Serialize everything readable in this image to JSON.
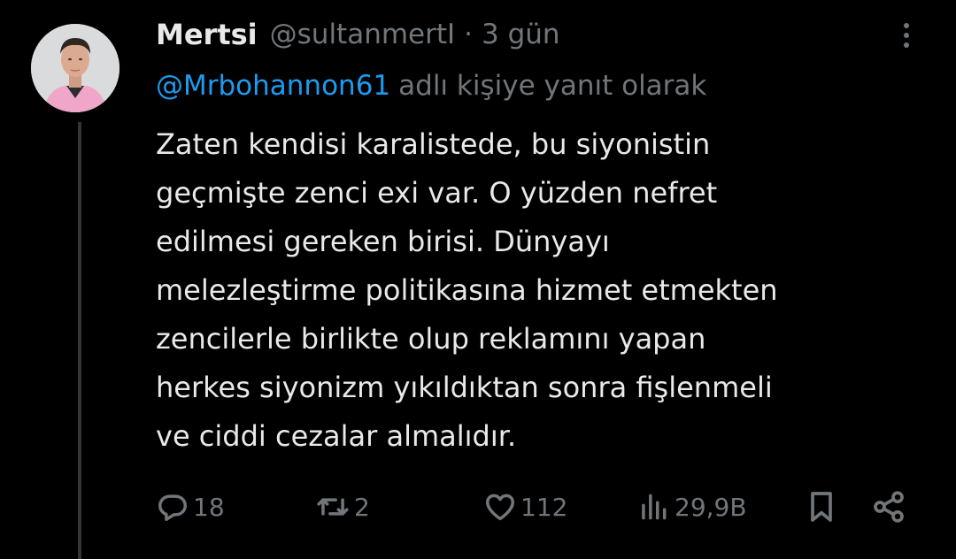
{
  "tweet": {
    "author": {
      "display_name": "Mertsi",
      "handle": "@sultanmertI",
      "separator": "·",
      "time": "3 gün"
    },
    "reply": {
      "mention": "@Mrbohannon61",
      "suffix": "adlı kişiye yanıt olarak"
    },
    "body_lines": [
      "Zaten kendisi karalistede, bu siyonistin",
      "geçmişte zenci exi var. O yüzden nefret",
      "edilmesi gereken birisi. Dünyayı",
      "melezleştirme politikasına hizmet etmekten",
      "zencilerle birlikte olup reklamını yapan",
      "herkes siyonizm yıkıldıktan sonra fişlenmeli",
      "ve ciddi cezalar almalıdır."
    ],
    "actions": {
      "replies": "18",
      "reposts": "2",
      "likes": "112",
      "views": "29,9B"
    },
    "icons": {
      "more": "more-vertical-icon",
      "reply": "reply-icon",
      "repost": "repost-icon",
      "like": "heart-icon",
      "views": "views-icon",
      "bookmark": "bookmark-icon",
      "share": "share-icon"
    },
    "colors": {
      "background": "#000000",
      "text": "#e7e9ea",
      "muted": "#71767b",
      "link": "#1d9bf0",
      "thread_line": "#333639"
    }
  }
}
